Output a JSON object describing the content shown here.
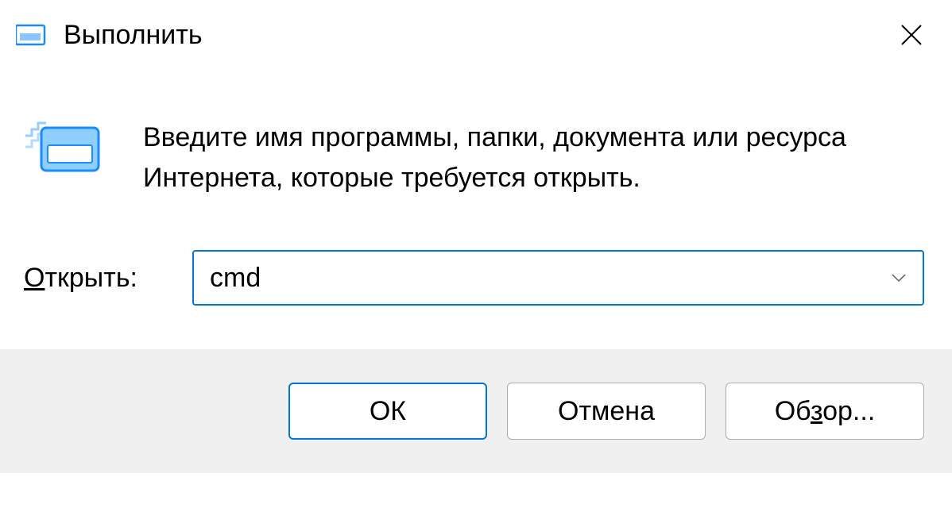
{
  "titlebar": {
    "title": "Выполнить"
  },
  "content": {
    "description": "Введите имя программы, папки, документа или ресурса Интернета, которые требуется открыть.",
    "open_label_underline": "О",
    "open_label_rest": "ткрыть:",
    "input_value": "cmd"
  },
  "buttons": {
    "ok": "ОК",
    "cancel": "Отмена",
    "browse_prefix": "Об",
    "browse_underline": "з",
    "browse_suffix": "ор..."
  }
}
